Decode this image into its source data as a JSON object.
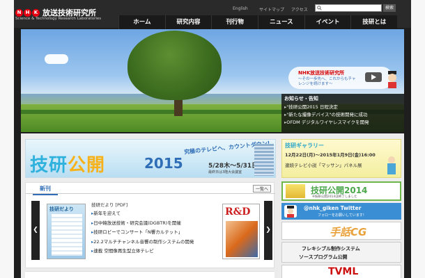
{
  "header": {
    "logo_badge": [
      "N",
      "H",
      "K"
    ],
    "logo_title": "放送技術研究所",
    "logo_subtitle": "Science & Technology Research Laboratories",
    "util_links": [
      "English",
      "サイトマップ",
      "アクセス"
    ],
    "search_button": "検索",
    "search_placeholder": ""
  },
  "nav": {
    "items": [
      "ホーム",
      "研究内容",
      "刊行物",
      "ニュース",
      "イベント",
      "技研とは"
    ]
  },
  "hero": {
    "promo_title": "NHK放送技術研究所",
    "promo_subtitle": "～その一歩先へ、これからもチャレンジを続けます～"
  },
  "notices": {
    "title": "お知らせ・告知",
    "items": [
      "\"技研公開2015 日程決定",
      "\"新たな撮像デバイス\"の技術開発に成功",
      "OFDM デジタルワイヤレスマイクを開発"
    ]
  },
  "banner": {
    "title_a": "技研",
    "title_b": "公開",
    "year": "2015",
    "catch": "究極のテレビへ、カウントダウン!",
    "date": "5/28木～5/31日",
    "note": "最終日は3階大会議室"
  },
  "gallery": {
    "title": "技研ギャラリー",
    "date": "12月22日(月)～2015年1月9日(金)16:00",
    "desc": "連続テレビ小説「マッサン」パネル展"
  },
  "newpub": {
    "tab": "新刊",
    "more": "一覧へ",
    "mag1_title": "技研だより",
    "mag2_title": "R&D",
    "head": "技研だより [PDF]",
    "items": [
      "新年を迎えて",
      "日中韓放送技術・研究会議(DGBTR)を開催",
      "技研ロビーでコンサート「N響カルテット」",
      "22.2マルチチャンネル音響の制作システムの開発",
      "連載 空間像再生型立体テレビ"
    ]
  },
  "side_ads": {
    "open2014_title": "技研公開2014",
    "open2014_sub": "※技研公開2014は終了しました",
    "twitter_handle": "@nhk_giken Twitter",
    "twitter_follow": "フォローをお願いしています!",
    "cg_logo": "手話CG",
    "flex_line1": "フレキシブル制作システム",
    "flex_line2": "ソースプログラム公開",
    "tvml_logo": "TVML"
  }
}
